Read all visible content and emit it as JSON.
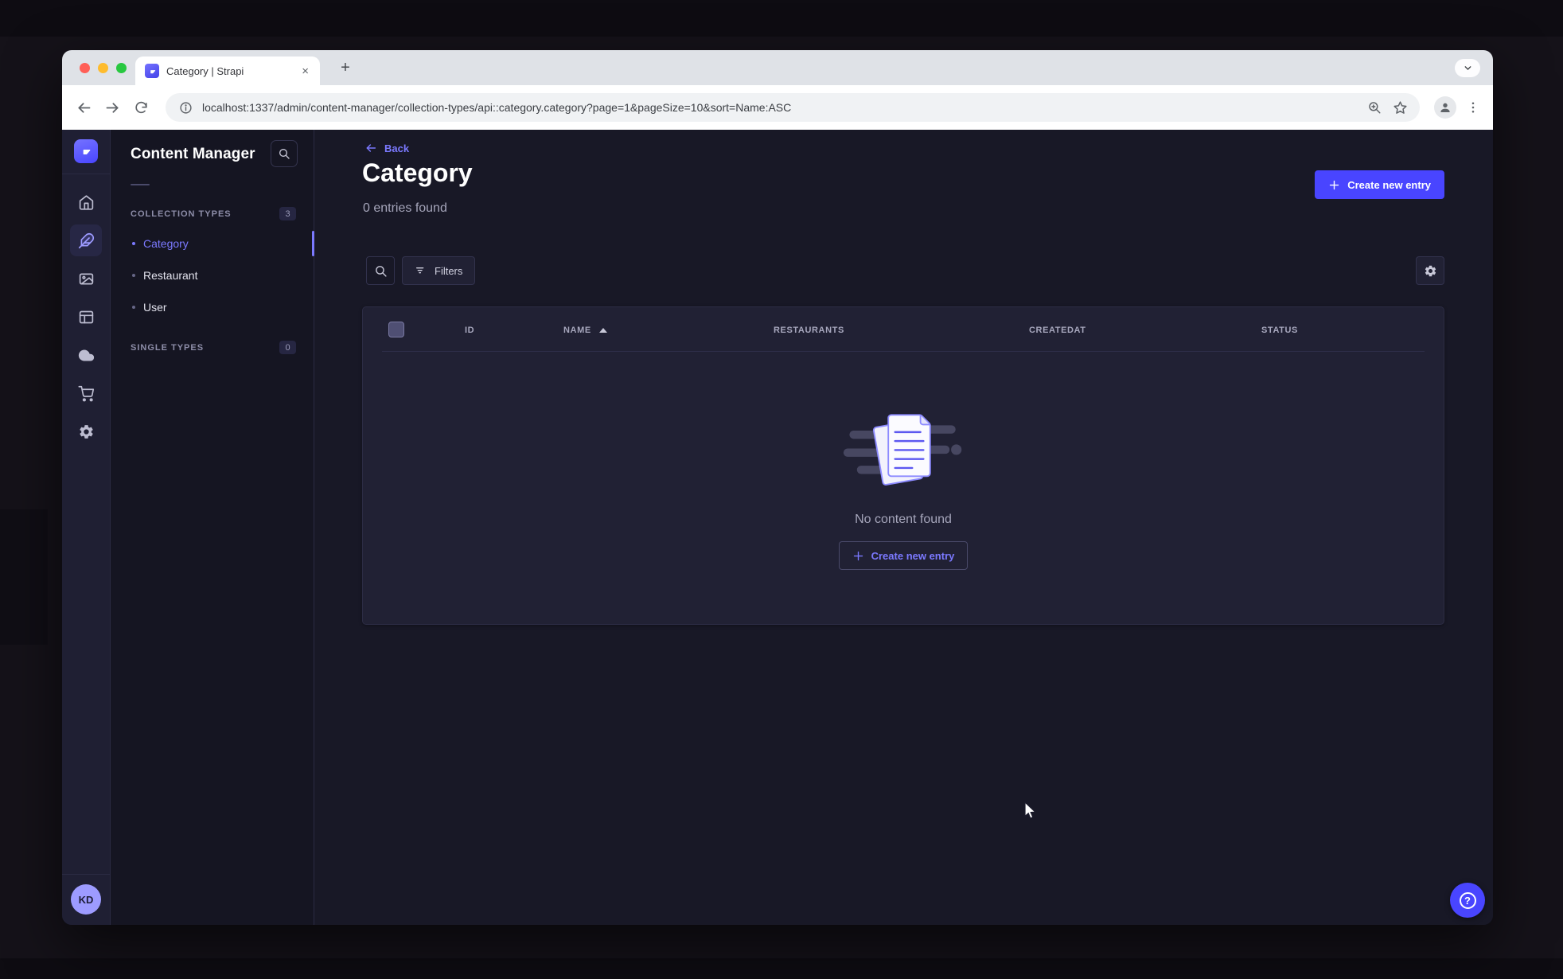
{
  "browser": {
    "tab": {
      "title": "Category | Strapi",
      "close_glyph": "×"
    },
    "new_tab_glyph": "+",
    "url": "localhost:1337/admin/content-manager/collection-types/api::category.category?page=1&pageSize=10&sort=Name:ASC"
  },
  "app": {
    "subnav": {
      "title": "Content Manager",
      "sections": [
        {
          "label": "COLLECTION TYPES",
          "count": "3",
          "items": [
            {
              "label": "Category",
              "active": true
            },
            {
              "label": "Restaurant",
              "active": false
            },
            {
              "label": "User",
              "active": false
            }
          ]
        },
        {
          "label": "SINGLE TYPES",
          "count": "0",
          "items": []
        }
      ]
    },
    "header": {
      "back_label": "Back",
      "title": "Category",
      "subtitle": "0 entries found",
      "create_button": "Create new entry"
    },
    "toolbar": {
      "filters_label": "Filters"
    },
    "table": {
      "columns": [
        "ID",
        "NAME",
        "RESTAURANTS",
        "CREATEDAT",
        "STATUS"
      ],
      "sorted_column": "NAME",
      "sort_direction": "ASC",
      "empty": {
        "message": "No content found",
        "create_button": "Create new entry"
      }
    },
    "user": {
      "initials": "KD"
    }
  },
  "icons": {
    "browser": [
      "strapi-favicon",
      "close-icon",
      "new-tab-icon",
      "chevron-down-icon",
      "back-icon",
      "forward-icon",
      "reload-icon",
      "info-icon",
      "zoom-icon",
      "star-icon",
      "profile-icon",
      "kebab-menu-icon"
    ],
    "sidebar": [
      "strapi-logo",
      "home-icon",
      "feather-icon",
      "media-library-icon",
      "content-type-builder-icon",
      "cloud-icon",
      "marketplace-cart-icon",
      "settings-gear-icon"
    ],
    "content": [
      "search-icon",
      "filter-icon",
      "gear-icon",
      "plus-icon",
      "sort-asc-icon",
      "empty-documents-illustration",
      "question-mark-icon",
      "mouse-cursor"
    ]
  },
  "colors": {
    "accent": "#4945ff",
    "accent_light": "#7b79ff",
    "page_bg": "#181826",
    "card_bg": "#212134",
    "subnav_bg": "#151522",
    "nav_bg": "#1f1f33",
    "border": "#32324d",
    "text_muted": "#a5a5ba",
    "traffic_red": "#ff5f57",
    "traffic_yellow": "#febc2e",
    "traffic_green": "#28c840"
  }
}
